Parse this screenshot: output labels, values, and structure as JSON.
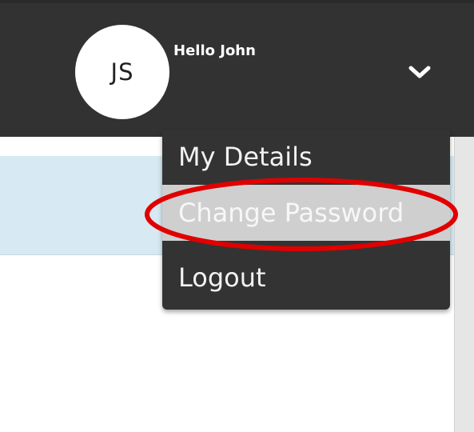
{
  "header": {
    "avatar_initials": "JS",
    "greeting": "Hello John",
    "dropdown_icon": "chevron-down-icon"
  },
  "menu": {
    "items": [
      {
        "label": "My Details",
        "state": "normal"
      },
      {
        "label": "Change Password",
        "state": "hover"
      },
      {
        "label": "Logout",
        "state": "normal"
      }
    ]
  },
  "annotation": {
    "shape": "ellipse",
    "color": "#e00000",
    "target": "Change Password"
  },
  "colors": {
    "topbar": "#323232",
    "dropdown": "#333333",
    "hover_item": "#cfcfcf",
    "panel_band": "#d7eaf3"
  }
}
